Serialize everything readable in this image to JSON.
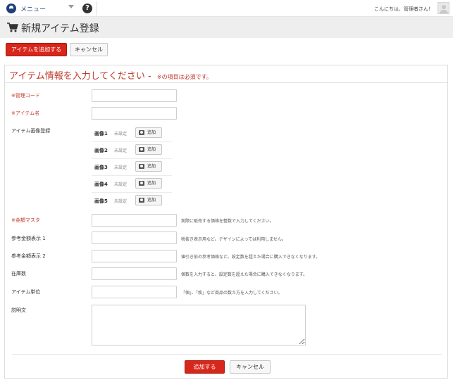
{
  "topbar": {
    "menu_label": "メニュー",
    "greeting": "こんにちは、管理者さん！"
  },
  "titlebar": {
    "title": "新規アイテム登録"
  },
  "toolbar": {
    "add_label": "アイテムを追加する",
    "cancel_label": "キャンセル"
  },
  "form": {
    "heading": "アイテム情報を入力してください - ",
    "required_note": "※の項目は必須です。",
    "fields": {
      "code_label": "※管理コード",
      "name_label": "※アイテム名",
      "image_label": "アイテム画像登録",
      "price_label": "※金額マスタ",
      "price_help": "実際に販売する価格を整数で入力してください。",
      "ref1_label": "参考金額表示 1",
      "ref1_help": "税抜き表示用など。デザインによっては利用しません。",
      "ref2_label": "参考金額表示 2",
      "ref2_help": "値引き前の参考価格など。設定数を超えた場合に購入できなくなります。",
      "stock_label": "在庫数",
      "stock_help": "個数を入力すると、設定数を超えた場合に購入できなくなります。",
      "unit_label": "アイテム単位",
      "unit_help": "「個」、「枚」など商品の数え方を入力してください。",
      "desc_label": "説明文"
    },
    "images": [
      {
        "name": "画像1",
        "status": "未設定",
        "add": "追加"
      },
      {
        "name": "画像2",
        "status": "未設定",
        "add": "追加"
      },
      {
        "name": "画像3",
        "status": "未設定",
        "add": "追加"
      },
      {
        "name": "画像4",
        "status": "未設定",
        "add": "追加"
      },
      {
        "name": "画像5",
        "status": "未設定",
        "add": "追加"
      }
    ],
    "submit_label": "追加する",
    "cancel_label": "キャンセル"
  },
  "colors": {
    "accent": "#d8261a",
    "required_text": "#c0392b",
    "header_bg": "#eeeeee"
  },
  "icons": [
    "user-menu-icon",
    "chevron-down-icon",
    "help-icon",
    "avatar-icon",
    "cart-icon",
    "camera-icon"
  ]
}
